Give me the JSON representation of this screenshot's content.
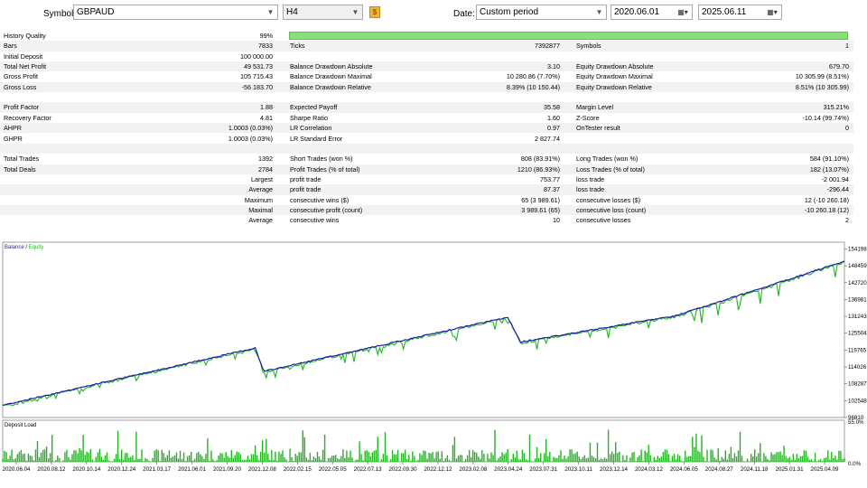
{
  "toolbar": {
    "symbol_label": "Symbol:",
    "symbol_value": "GBPAUD",
    "timeframe_value": "H4",
    "date_label": "Date:",
    "period_value": "Custom period",
    "date_from": "2020.06.01",
    "date_to": "2025.06.11"
  },
  "report": {
    "history_quality_label": "History Quality",
    "history_quality_value": "99%",
    "quality_fill": 1.0,
    "rows": [
      {
        "c1l": "Bars",
        "c1v": "7833",
        "c2l": "Ticks",
        "c2v": "7392877",
        "c3l": "Symbols",
        "c3v": "1"
      },
      {
        "c1l": "Initial Deposit",
        "c1v": "100 000.00",
        "c2l": "",
        "c2v": "",
        "c3l": "",
        "c3v": ""
      },
      {
        "c1l": "Total Net Profit",
        "c1v": "49 531.73",
        "c2l": "Balance Drawdown Absolute",
        "c2v": "3.10",
        "c3l": "Equity Drawdown Absolute",
        "c3v": "679.70"
      },
      {
        "c1l": "Gross Profit",
        "c1v": "105 715.43",
        "c2l": "Balance Drawdown Maximal",
        "c2v": "10 280.86 (7.70%)",
        "c3l": "Equity Drawdown Maximal",
        "c3v": "10 305.99 (8.51%)"
      },
      {
        "c1l": "Gross Loss",
        "c1v": "-56 183.70",
        "c2l": "Balance Drawdown Relative",
        "c2v": "8.39% (10 150.44)",
        "c3l": "Equity Drawdown Relative",
        "c3v": "8.51% (10 305.99)"
      },
      {
        "c1l": "",
        "c1v": "",
        "c2l": "",
        "c2v": "",
        "c3l": "",
        "c3v": ""
      },
      {
        "c1l": "Profit Factor",
        "c1v": "1.88",
        "c2l": "Expected Payoff",
        "c2v": "35.58",
        "c3l": "Margin Level",
        "c3v": "315.21%"
      },
      {
        "c1l": "Recovery Factor",
        "c1v": "4.81",
        "c2l": "Sharpe Ratio",
        "c2v": "1.60",
        "c3l": "Z-Score",
        "c3v": "-10.14 (99.74%)"
      },
      {
        "c1l": "AHPR",
        "c1v": "1.0003 (0.03%)",
        "c2l": "LR Correlation",
        "c2v": "0.97",
        "c3l": "OnTester result",
        "c3v": "0"
      },
      {
        "c1l": "GHPR",
        "c1v": "1.0003 (0.03%)",
        "c2l": "LR Standard Error",
        "c2v": "2 827.74",
        "c3l": "",
        "c3v": ""
      },
      {
        "c1l": "",
        "c1v": "",
        "c2l": "",
        "c2v": "",
        "c3l": "",
        "c3v": ""
      },
      {
        "c1l": "Total Trades",
        "c1v": "1392",
        "c2l": "Short Trades (won %)",
        "c2v": "808 (83.91%)",
        "c3l": "Long Trades (won %)",
        "c3v": "584 (91.10%)"
      },
      {
        "c1l": "Total Deals",
        "c1v": "2784",
        "c2l": "Profit Trades (% of total)",
        "c2v": "1210 (86.93%)",
        "c3l": "Loss Trades (% of total)",
        "c3v": "182 (13.07%)"
      },
      {
        "c1l": "",
        "c1v": "Largest",
        "c2l": "profit trade",
        "c2v": "753.77",
        "c3l": "loss trade",
        "c3v": "-2 001.94"
      },
      {
        "c1l": "",
        "c1v": "Average",
        "c2l": "profit trade",
        "c2v": "87.37",
        "c3l": "loss trade",
        "c3v": "-296.44"
      },
      {
        "c1l": "",
        "c1v": "Maximum",
        "c2l": "consecutive wins ($)",
        "c2v": "65 (3 989.61)",
        "c3l": "consecutive losses ($)",
        "c3v": "12 (-10 260.18)"
      },
      {
        "c1l": "",
        "c1v": "Maximal",
        "c2l": "consecutive profit (count)",
        "c2v": "3 989.61 (65)",
        "c3l": "consecutive loss (count)",
        "c3v": "-10 260.18 (12)"
      },
      {
        "c1l": "",
        "c1v": "Average",
        "c2l": "consecutive wins",
        "c2v": "10",
        "c3l": "consecutive losses",
        "c3v": "2"
      }
    ]
  },
  "chart_data": [
    {
      "type": "line",
      "legend": [
        "Balance",
        "Equity"
      ],
      "legend_position": "top-left",
      "colors": {
        "balance": "#1a1aa6",
        "equity": "#22b422"
      },
      "y_ticks": [
        154198,
        148459,
        142720,
        136981,
        131243,
        125504,
        119765,
        114026,
        108287,
        102548,
        96810
      ],
      "ylim": [
        96810,
        156500
      ],
      "x_ticks": [
        "2020.06.04",
        "2020.08.12",
        "2020.10.14",
        "2020.12.24",
        "2021.03.17",
        "2021.06.01",
        "2021.09.20",
        "2021.12.08",
        "2022.02.15",
        "2022.05.05",
        "2022.07.13",
        "2022.09.30",
        "2022.12.12",
        "2023.02.08",
        "2023.04.24",
        "2023.07.31",
        "2023.10.11",
        "2023.12.14",
        "2024.03.12",
        "2024.06.05",
        "2024.08.27",
        "2024.11.18",
        "2025.01.31",
        "2025.04.09"
      ],
      "balance": [
        [
          0,
          101000
        ],
        [
          0.3,
          120500
        ],
        [
          0.31,
          112500
        ],
        [
          0.6,
          131000
        ],
        [
          0.615,
          122500
        ],
        [
          0.8,
          131500
        ],
        [
          1.0,
          150000
        ]
      ]
    },
    {
      "type": "bar",
      "title": "Deposit Load",
      "y_ticks": [
        "55.0%",
        "0.0%"
      ],
      "color": "#22b422"
    }
  ]
}
